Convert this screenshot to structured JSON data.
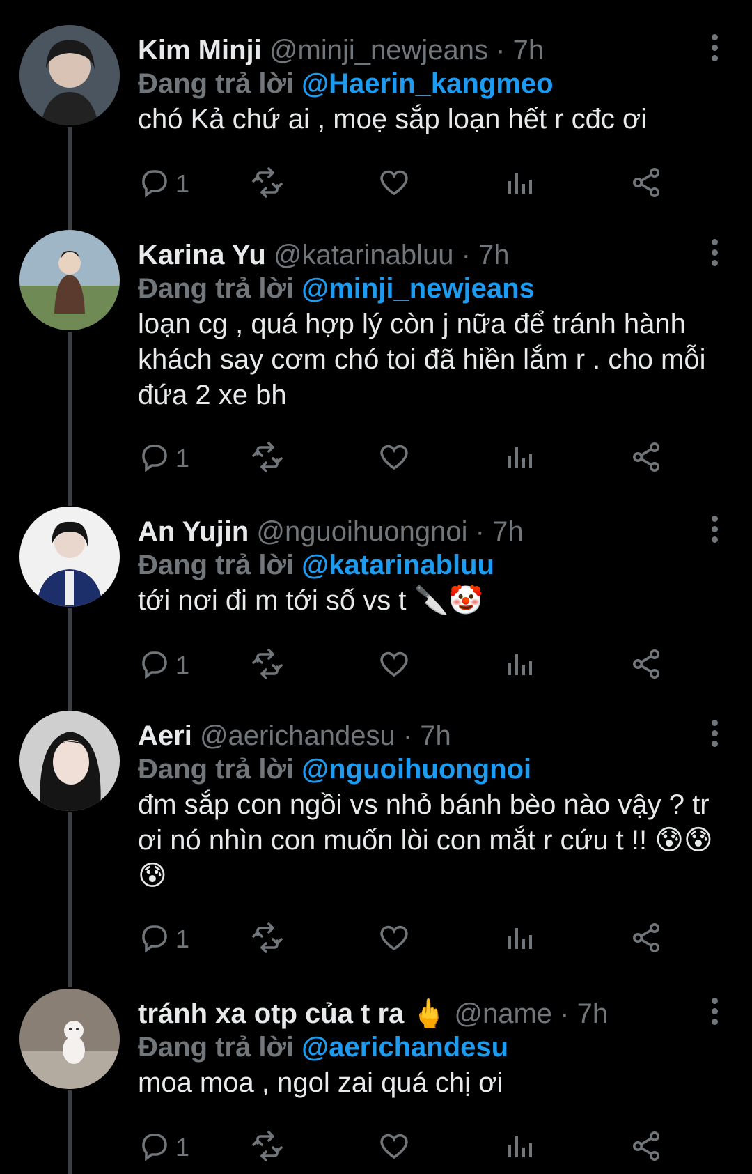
{
  "tweets": [
    {
      "name": "Kim Minji",
      "handle": "@minji_newjeans",
      "time": "7h",
      "reply_label": "Đang trả lời",
      "reply_to": "@Haerin_kangmeo",
      "text": "chó Kả chứ ai , moẹ sắp loạn hết r cđc ơi",
      "reply_count": "1"
    },
    {
      "name": "Karina Yu",
      "handle": "@katarinabluu",
      "time": "7h",
      "reply_label": "Đang trả lời",
      "reply_to": "@minji_newjeans",
      "text": "loạn cg , quá hợp lý còn j nữa để tránh hành khách say cơm chó toi đã hiền lắm r . cho mỗi đứa 2 xe bh",
      "reply_count": "1"
    },
    {
      "name": "An Yujin",
      "handle": "@nguoihuongnoi",
      "time": "7h",
      "reply_label": "Đang trả lời",
      "reply_to": "@katarinabluu",
      "text": "tới nơi đi m tới số vs t 🔪🤡",
      "reply_count": "1"
    },
    {
      "name": "Aeri",
      "handle": "@aerichandesu",
      "time": "7h",
      "reply_label": "Đang trả lời",
      "reply_to": "@nguoihuongnoi",
      "text": "đm sắp con ngồi vs nhỏ bánh bèo nào vậy ? tr ơi nó nhìn con muốn lòi con mắt r cứu t !! 😰😰😰",
      "reply_count": "1"
    },
    {
      "name": "tránh xa otp của t ra 🖕",
      "handle": "@name",
      "time": "7h",
      "reply_label": "Đang trả lời",
      "reply_to": "@aerichandesu",
      "text": "moa moa , ngol zai quá chị ơi",
      "reply_count": "1"
    }
  ],
  "separator": "·",
  "icons": [
    "more-vertical-icon",
    "reply-icon",
    "retweet-icon",
    "like-icon",
    "views-icon",
    "share-icon"
  ],
  "colors": {
    "background": "#000000",
    "text": "#e7e9ea",
    "muted": "#71767b",
    "accent": "#1d9bf0"
  }
}
